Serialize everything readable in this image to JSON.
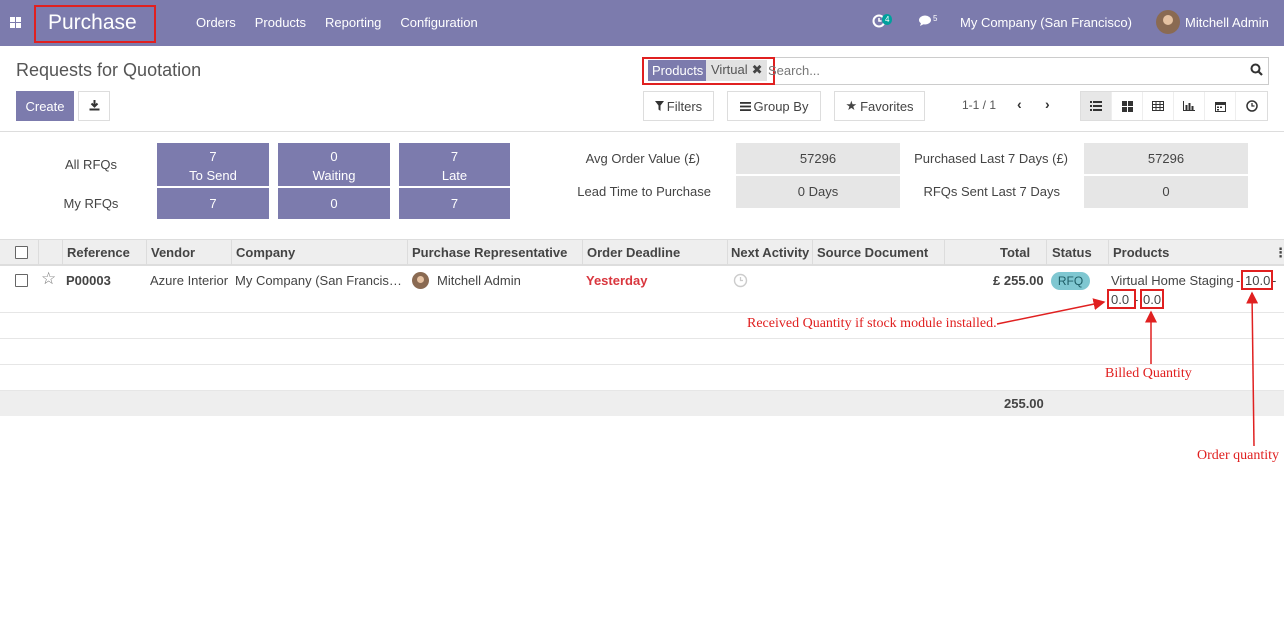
{
  "navbar": {
    "app_title": "Purchase",
    "menu": [
      "Orders",
      "Products",
      "Reporting",
      "Configuration"
    ],
    "activity_count": "4",
    "message_count": "5",
    "company": "My Company (San Francisco)",
    "user": "Mitchell Admin"
  },
  "control_panel": {
    "title": "Requests for Quotation",
    "create_label": "Create",
    "search": {
      "facet_label": "Products",
      "facet_value": "Virtual",
      "placeholder": "Search..."
    },
    "filters_label": "Filters",
    "groupby_label": "Group By",
    "favorites_label": "Favorites",
    "pager": "1-1 / 1",
    "views": [
      "list",
      "kanban",
      "pivot",
      "graph",
      "calendar",
      "activity"
    ]
  },
  "dashboard": {
    "row_labels": [
      "All RFQs",
      "My RFQs"
    ],
    "tiles": [
      {
        "all": "7",
        "label": "To Send",
        "my": "7"
      },
      {
        "all": "0",
        "label": "Waiting",
        "my": "0"
      },
      {
        "all": "7",
        "label": "Late",
        "my": "7"
      }
    ],
    "metrics": [
      {
        "label": "Avg Order Value (£)",
        "value": "57296"
      },
      {
        "label": "Purchased Last 7 Days (£)",
        "value": "57296"
      },
      {
        "label": "Lead Time to Purchase",
        "value": "0  Days"
      },
      {
        "label": "RFQs Sent Last 7 Days",
        "value": "0"
      }
    ]
  },
  "table": {
    "columns": [
      "Reference",
      "Vendor",
      "Company",
      "Purchase Representative",
      "Order Deadline",
      "Next Activity",
      "Source Document",
      "Total",
      "Status",
      "Products"
    ],
    "rows": [
      {
        "reference": "P00003",
        "vendor": "Azure Interior",
        "company": "My Company (San Francis…",
        "representative": "Mitchell Admin",
        "deadline": "Yesterday",
        "total": "£ 255.00",
        "status": "RFQ",
        "product_name": "Virtual Home Staging",
        "order_qty": "10.0",
        "received_qty": "0.0",
        "billed_qty": "0.0"
      }
    ],
    "footer_total": "255.00"
  },
  "annotations": {
    "received": "Received Quantity if stock module installed.",
    "billed": "Billed Quantity",
    "order": "Order quantity"
  },
  "colors": {
    "brand": "#7c7bad",
    "annotation": "#e02020",
    "deadline": "#d9363e",
    "status_badge": "#7fc7d1"
  }
}
